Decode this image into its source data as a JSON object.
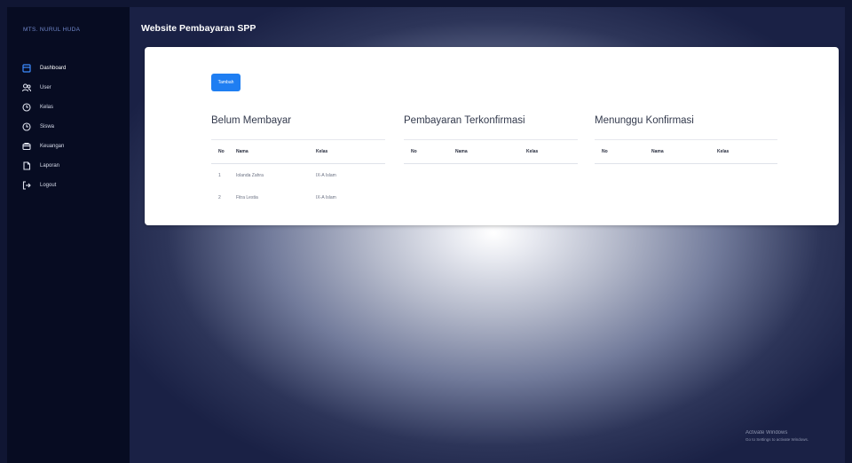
{
  "sidebar": {
    "brand": "MTS. NURUL HUDA",
    "items": [
      {
        "label": "Dashboard",
        "icon": "dashboard-icon",
        "active": true
      },
      {
        "label": "User",
        "icon": "users-icon",
        "active": false
      },
      {
        "label": "Kelas",
        "icon": "clock-icon",
        "active": false
      },
      {
        "label": "Siswa",
        "icon": "clock-icon",
        "active": false
      },
      {
        "label": "Keuangan",
        "icon": "wallet-icon",
        "active": false
      },
      {
        "label": "Laporan",
        "icon": "document-icon",
        "active": false
      },
      {
        "label": "Logout",
        "icon": "logout-icon",
        "active": false
      }
    ]
  },
  "header": {
    "title": "Website Pembayaran SPP"
  },
  "card": {
    "button_label": "Tambah",
    "sections": [
      {
        "title": "Belum Membayar",
        "columns": [
          "No",
          "Nama",
          "Kelas"
        ],
        "rows": [
          [
            "1",
            "Iolanda Zahra",
            "IX-A Islam"
          ],
          [
            "2",
            "Fitra Lestia",
            "IX-A Islam"
          ]
        ]
      },
      {
        "title": "Pembayaran Terkonfirmasi",
        "columns": [
          "No",
          "Nama",
          "Kelas"
        ],
        "rows": []
      },
      {
        "title": "Menunggu Konfirmasi",
        "columns": [
          "No",
          "Nama",
          "Kelas"
        ],
        "rows": []
      }
    ]
  },
  "watermark": {
    "line1": "Activate Windows",
    "line2": "Go to Settings to activate Windows."
  },
  "colors": {
    "sidebar_bg": "#070c22",
    "accent": "#1f7ef2",
    "card_bg": "#ffffff"
  }
}
